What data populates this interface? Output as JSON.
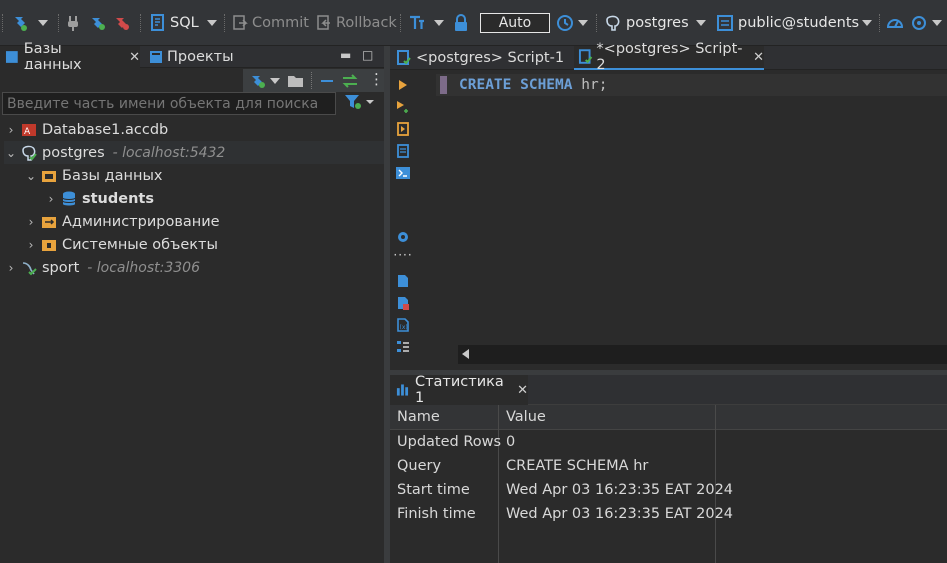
{
  "toolbar": {
    "sql_label": "SQL",
    "commit_label": "Commit",
    "rollback_label": "Rollback",
    "auto_label": "Auto",
    "datasource_label": "postgres",
    "schema_label": "public@students"
  },
  "left_panel": {
    "tabs": [
      {
        "label": "Базы данных"
      },
      {
        "label": "Проекты"
      }
    ],
    "search_placeholder": "Введите часть имени объекта для поиска",
    "tree": [
      {
        "label": "Database1.accdb",
        "host": ""
      },
      {
        "label": "postgres",
        "host": "- localhost:5432"
      },
      {
        "label": "Базы данных",
        "host": ""
      },
      {
        "label": "students",
        "host": ""
      },
      {
        "label": "Администрирование",
        "host": ""
      },
      {
        "label": "Системные объекты",
        "host": ""
      },
      {
        "label": "sport",
        "host": "- localhost:3306"
      }
    ]
  },
  "editor": {
    "tabs": [
      {
        "label": "<postgres> Script-1"
      },
      {
        "label": "*<postgres> Script-2"
      }
    ],
    "code_keywords": "CREATE SCHEMA",
    "code_rest": "hr;"
  },
  "results": {
    "tab_label": "Статистика 1",
    "columns": [
      "Name",
      "Value"
    ],
    "rows": [
      {
        "name": "Updated Rows",
        "value": "0"
      },
      {
        "name": "Query",
        "value": "CREATE SCHEMA hr"
      },
      {
        "name": "Start time",
        "value": "Wed Apr 03 16:23:35 EAT 2024"
      },
      {
        "name": "Finish time",
        "value": "Wed Apr 03 16:23:35 EAT 2024"
      }
    ]
  },
  "colors": {
    "keyword": "#6c9fd6",
    "accent_blue": "#3d8fd8",
    "background": "#2b2b2b"
  }
}
